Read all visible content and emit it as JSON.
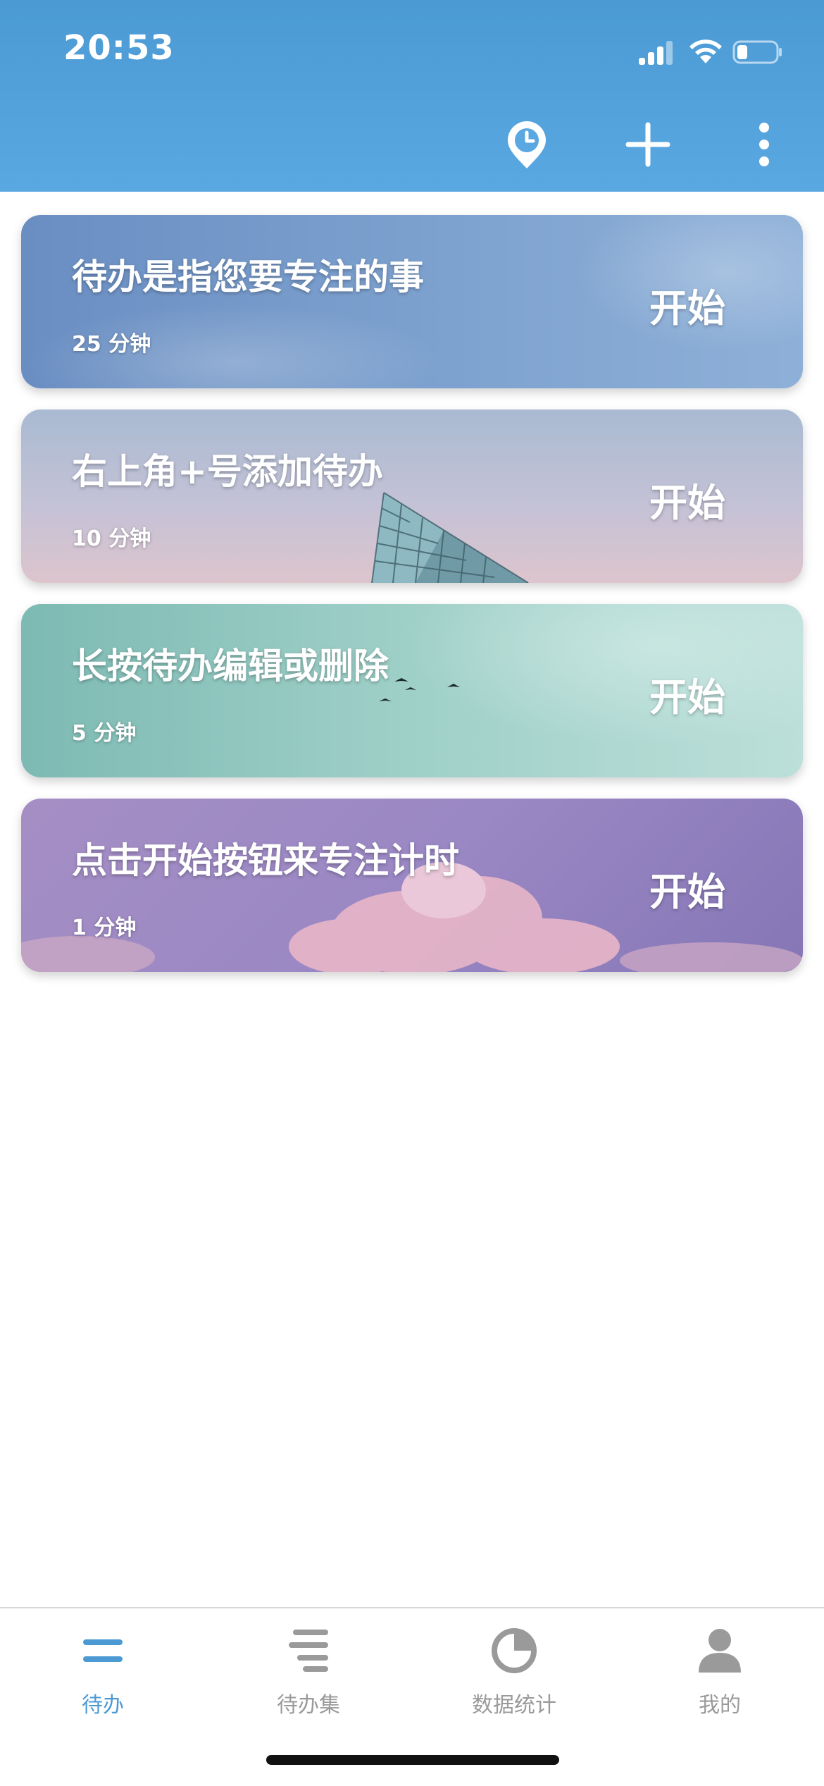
{
  "status_bar": {
    "time": "20:53",
    "signal_icon": "cellular-signal-icon",
    "wifi_icon": "wifi-icon",
    "battery_icon": "battery-icon",
    "battery_level": 0.2
  },
  "header": {
    "actions": [
      {
        "icon": "timer-pin-icon"
      },
      {
        "icon": "plus-icon"
      },
      {
        "icon": "more-vertical-icon"
      }
    ]
  },
  "todos": [
    {
      "title": "待办是指您要专注的事",
      "duration": "25 分钟",
      "action": "开始"
    },
    {
      "title": "右上角+号添加待办",
      "duration": "10 分钟",
      "action": "开始"
    },
    {
      "title": "长按待办编辑或删除",
      "duration": "5 分钟",
      "action": "开始"
    },
    {
      "title": "点击开始按钮来专注计时",
      "duration": "1 分钟",
      "action": "开始"
    }
  ],
  "tabs": [
    {
      "label": "待办",
      "icon": "todo-list-icon",
      "active": true
    },
    {
      "label": "待办集",
      "icon": "todo-collection-icon",
      "active": false
    },
    {
      "label": "数据统计",
      "icon": "pie-chart-icon",
      "active": false
    },
    {
      "label": "我的",
      "icon": "person-icon",
      "active": false
    }
  ],
  "colors": {
    "header_blue": "#4b9ad4",
    "tab_active": "#4b9ad4",
    "tab_inactive": "#9a9a9a"
  }
}
